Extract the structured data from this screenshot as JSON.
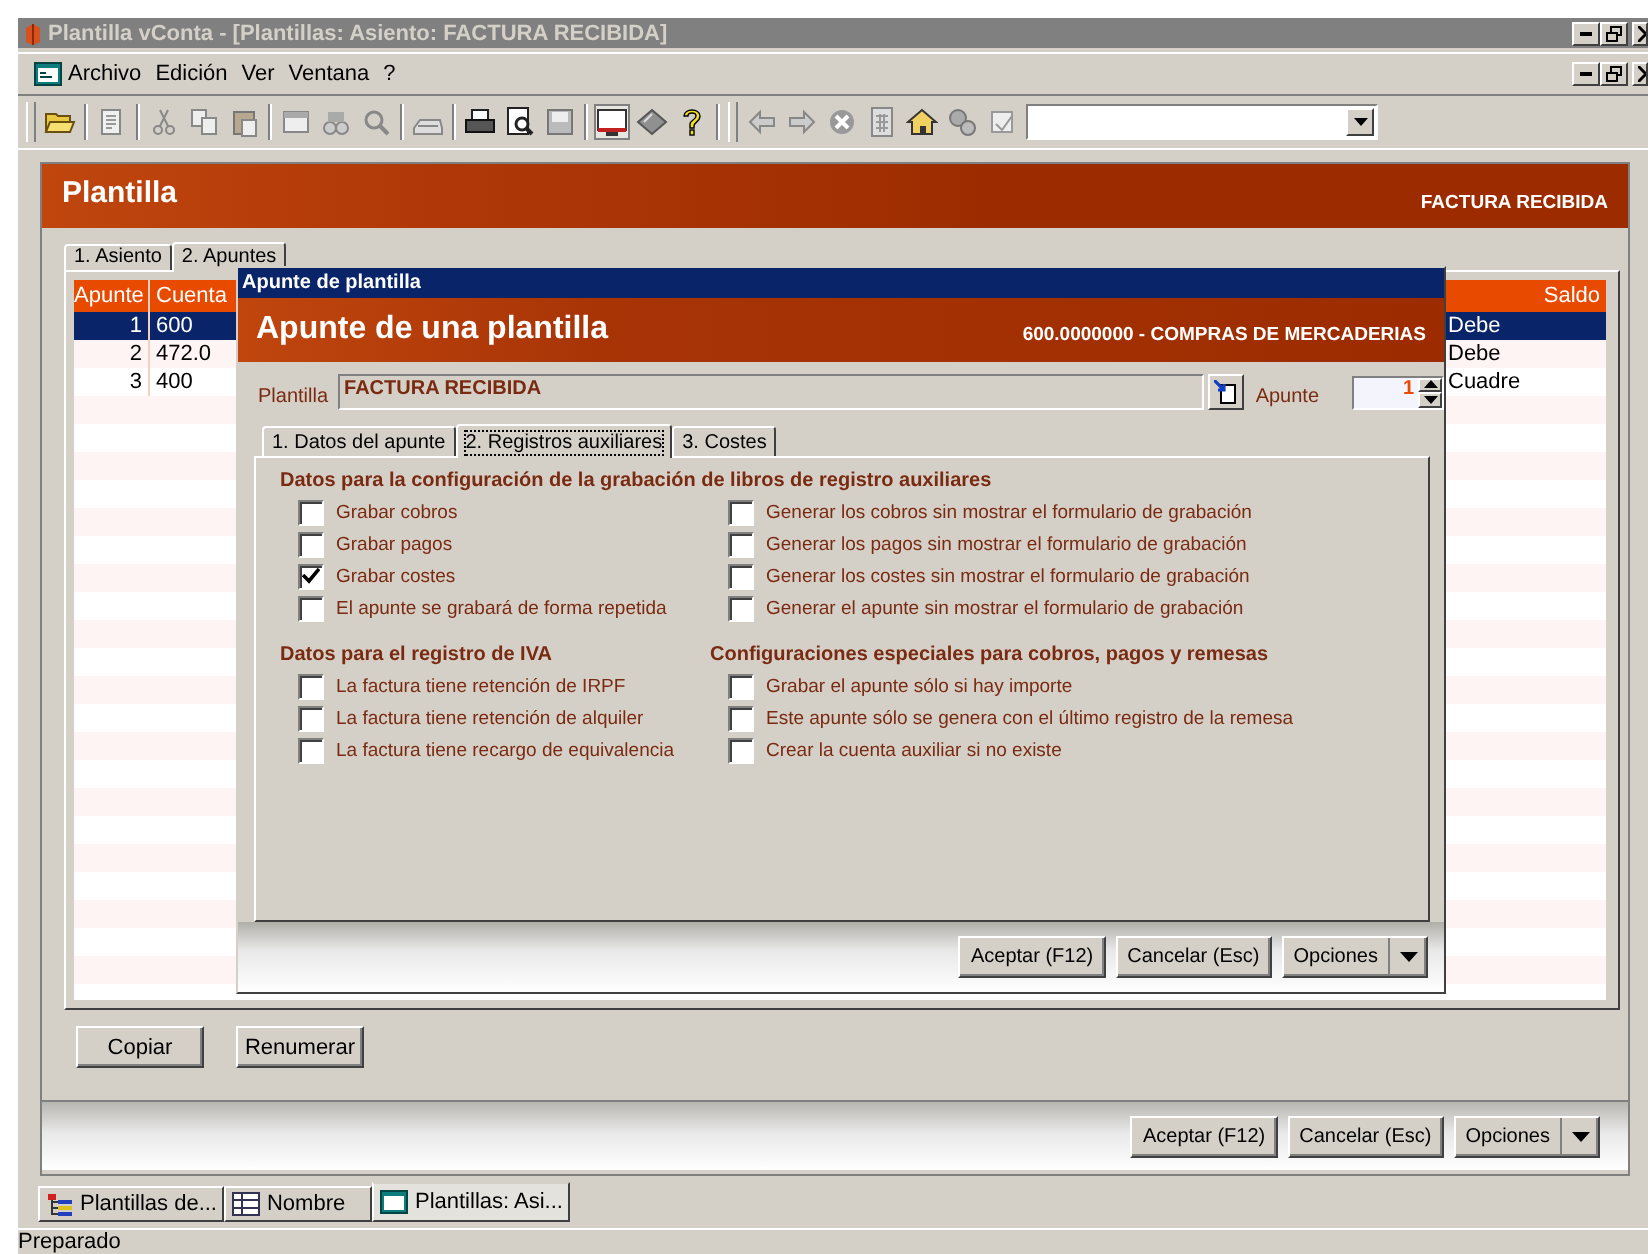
{
  "window": {
    "title": "Plantilla vConta - [Plantillas: Asiento: FACTURA RECIBIDA]"
  },
  "menu": [
    "Archivo",
    "Edición",
    "Ver",
    "Ventana",
    "?"
  ],
  "child": {
    "title": "Plantilla",
    "subtitle": "FACTURA RECIBIDA",
    "tabs": [
      {
        "label": "1. Asiento",
        "selected": false
      },
      {
        "label": "2. Apuntes",
        "selected": true
      }
    ],
    "table": {
      "columns": [
        "Apunte",
        "Cuenta",
        "Saldo"
      ],
      "rows": [
        {
          "apunte": "1",
          "cuenta": "600",
          "saldo": "Debe",
          "selected": true
        },
        {
          "apunte": "2",
          "cuenta": "472.0",
          "saldo": "Debe",
          "selected": false
        },
        {
          "apunte": "3",
          "cuenta": "400",
          "saldo": "Cuadre",
          "selected": false
        }
      ]
    },
    "actions": [
      "Copiar",
      "Renumerar"
    ],
    "buttons": [
      "Aceptar (F12)",
      "Cancelar (Esc)",
      "Opciones"
    ]
  },
  "dialog": {
    "title": "Apunte de plantilla",
    "heading": "Apunte de una plantilla",
    "account": "600.0000000 - COMPRAS DE MERCADERIAS",
    "plantilla_label": "Plantilla",
    "plantilla_value": "FACTURA RECIBIDA",
    "apunte_label": "Apunte",
    "apunte_value": "1",
    "tabs": [
      {
        "label": "1. Datos del apunte",
        "selected": false
      },
      {
        "label": "2. Registros auxiliares",
        "selected": true
      },
      {
        "label": "3. Costes",
        "selected": false
      }
    ],
    "libros": {
      "title": "Datos para la configuración de la grabación de libros de registro auxiliares",
      "left": [
        {
          "label": "Grabar cobros",
          "checked": false
        },
        {
          "label": "Grabar pagos",
          "checked": false
        },
        {
          "label": "Grabar costes",
          "checked": true
        },
        {
          "label": "El apunte se grabará de forma repetida",
          "checked": false
        }
      ],
      "right": [
        {
          "label": "Generar los cobros sin mostrar el formulario de grabación",
          "checked": false
        },
        {
          "label": "Generar los pagos sin mostrar el formulario de grabación",
          "checked": false
        },
        {
          "label": "Generar los costes sin mostrar el formulario de grabación",
          "checked": false
        },
        {
          "label": "Generar el apunte sin mostrar el formulario de grabación",
          "checked": false
        }
      ]
    },
    "iva": {
      "title": "Datos para el registro de IVA",
      "options": [
        {
          "label": "La factura tiene retención de IRPF",
          "checked": false
        },
        {
          "label": "La factura tiene retención de alquiler",
          "checked": false
        },
        {
          "label": "La factura tiene recargo de equivalencia",
          "checked": false
        }
      ]
    },
    "especiales": {
      "title": "Configuraciones especiales para cobros, pagos y remesas",
      "options": [
        {
          "label": "Grabar el apunte sólo si hay importe",
          "checked": false
        },
        {
          "label": "Este apunte sólo se genera con el último registro de la remesa",
          "checked": false
        },
        {
          "label": "Crear la cuenta auxiliar si no existe",
          "checked": false
        }
      ]
    },
    "buttons": [
      "Aceptar (F12)",
      "Cancelar (Esc)",
      "Opciones"
    ]
  },
  "taskbar": [
    {
      "label": "Plantillas de...",
      "kind": "tree",
      "selected": false
    },
    {
      "label": "Nombre",
      "kind": "grid",
      "selected": false
    },
    {
      "label": "Plantillas: Asi...",
      "kind": "window",
      "selected": true
    }
  ],
  "status_bar": "Preparado"
}
